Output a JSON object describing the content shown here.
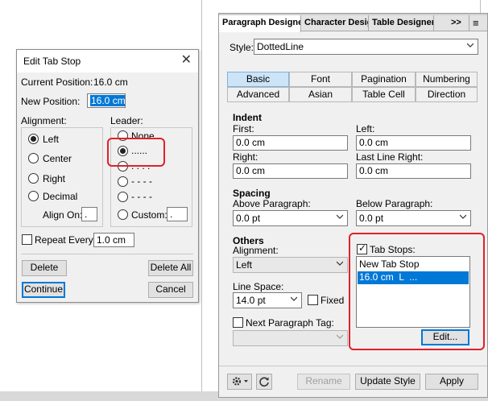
{
  "edit_tab_stop": {
    "title": "Edit Tab Stop",
    "close_glyph": "✕",
    "current_position_label": "Current Position:",
    "current_position_value": "16.0 cm",
    "new_position_label": "New Position:",
    "new_position_value": "16.0 cm",
    "alignment_label": "Alignment:",
    "alignment_options": [
      "Left",
      "Center",
      "Right",
      "Decimal"
    ],
    "alignment_selected": "Left",
    "align_on_label": "Align On:",
    "align_on_value": ".",
    "leader_label": "Leader:",
    "leader_options": [
      "None",
      "......",
      ". . . .",
      "- - - -",
      "-  -  -  -"
    ],
    "leader_selected": "......",
    "custom_label": "Custom:",
    "custom_value": ".",
    "repeat_every_label": "Repeat Every:",
    "repeat_every_checked": false,
    "repeat_every_value": "1.0 cm",
    "delete_label": "Delete",
    "delete_all_label": "Delete All",
    "continue_label": "Continue",
    "cancel_label": "Cancel"
  },
  "paragraph_designer": {
    "tabs": [
      "Paragraph Designer",
      "Character Desig",
      "Table Designer"
    ],
    "overflow_glyph": ">>",
    "menu_glyph": "≡",
    "style_label": "Style:",
    "style_value": "DottedLine",
    "subtabs_row1": [
      "Basic",
      "Font",
      "Pagination",
      "Numbering"
    ],
    "subtabs_row2": [
      "Advanced",
      "Asian",
      "Table Cell",
      "Direction"
    ],
    "active_subtab": "Basic",
    "indent": {
      "title": "Indent",
      "first_label": "First:",
      "first_value": "0.0 cm",
      "left_label": "Left:",
      "left_value": "0.0 cm",
      "right_label": "Right:",
      "right_value": "0.0 cm",
      "last_line_right_label": "Last Line Right:",
      "last_line_right_value": "0.0 cm"
    },
    "spacing": {
      "title": "Spacing",
      "above_label": "Above Paragraph:",
      "above_value": "0.0 pt",
      "below_label": "Below Paragraph:",
      "below_value": "0.0 pt"
    },
    "others": {
      "title": "Others",
      "alignment_label": "Alignment:",
      "alignment_value": "Left",
      "line_space_label": "Line Space:",
      "line_space_value": "14.0 pt",
      "fixed_label": "Fixed",
      "next_tag_label": "Next Paragraph Tag:",
      "next_tag_value": ""
    },
    "tab_stops": {
      "label": "Tab Stops:",
      "checked": true,
      "items": [
        "New Tab Stop",
        "16.0 cm  L  ..."
      ],
      "selected_index": 1,
      "edit_label": "Edit..."
    },
    "footer": {
      "gear_icon": "gear-icon",
      "refresh_icon": "refresh-icon",
      "rename_label": "Rename",
      "update_style_label": "Update Style",
      "apply_label": "Apply"
    }
  },
  "colors": {
    "highlight": "#e0202a",
    "selection": "#0078d7",
    "active_subtab": "#cce4f7"
  }
}
